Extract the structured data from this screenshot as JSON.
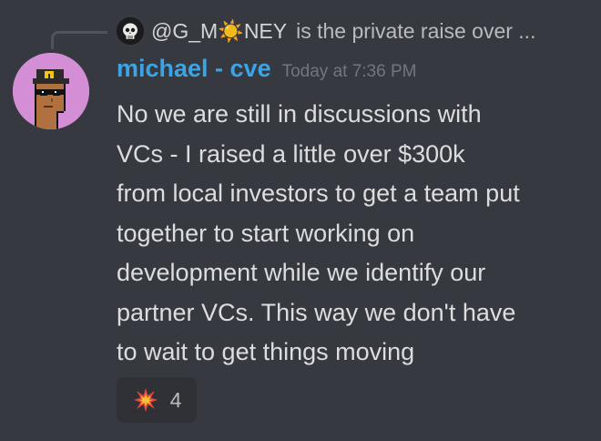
{
  "reply": {
    "author": "@G_M☀️NEY",
    "text": "is the private raise over ...",
    "avatar_icon": "skull-avatar-icon"
  },
  "message": {
    "username": "michael - cve",
    "timestamp": "Today at 7:36 PM",
    "lines": [
      "No we are still in discussions with",
      "VCs - I raised a little over $300k",
      "from local investors to get a team put",
      "together to start working on",
      "development while we identify our",
      "partner VCs.  This way we don't have",
      "to wait to get things moving"
    ],
    "avatar_icon": "pixel-punk-avatar-icon"
  },
  "reaction": {
    "emoji_icon": "collision-icon",
    "count": "4"
  },
  "colors": {
    "background": "#36393f",
    "username": "#3ba4e6",
    "timestamp": "#72767d",
    "text": "#dcddde",
    "reaction_bg": "#2f3136",
    "avatar_bg": "#d48ed6"
  }
}
